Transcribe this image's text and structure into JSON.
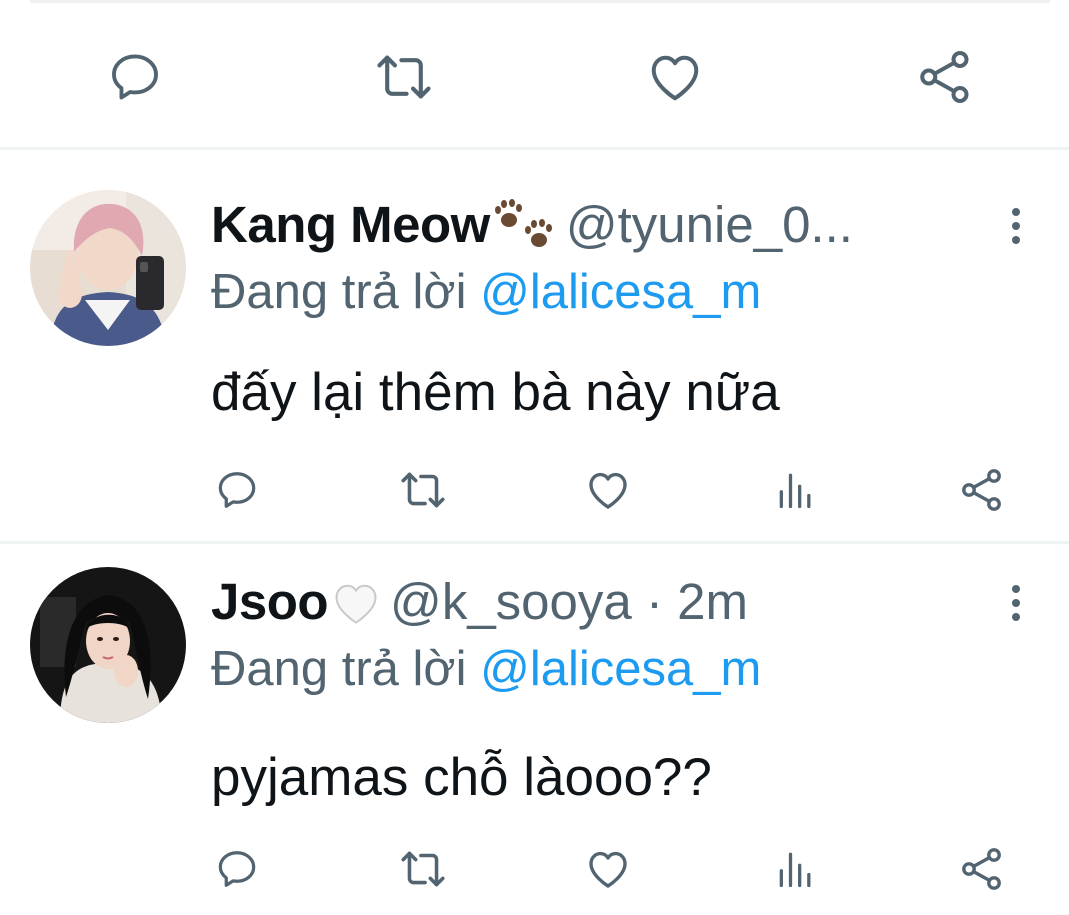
{
  "top_tweet_actions": {
    "reply_icon": "reply-bubble-icon",
    "retweet_icon": "retweet-icon",
    "like_icon": "heart-icon",
    "share_icon": "share-icon"
  },
  "replies": [
    {
      "display_name": "Kang Meow",
      "name_emoji": "paw-prints-emoji",
      "handle": "@tyunie_0...",
      "timestamp": "",
      "replying_prefix": "Đang trả lời",
      "replying_to": "@lalicesa_m",
      "text": "đấy lại thêm bà này nữa"
    },
    {
      "display_name": "Jsoo",
      "name_emoji": "white-heart-emoji",
      "handle": "@k_sooya",
      "timestamp": " · 2m",
      "replying_prefix": "Đang trả lời",
      "replying_to": "@lalicesa_m",
      "text": "pyjamas chỗ làooo??"
    }
  ],
  "colors": {
    "icon_gray": "#536471",
    "link_blue": "#1d9bf0",
    "text_dark": "#0f1419",
    "divider": "#eff3f4"
  }
}
